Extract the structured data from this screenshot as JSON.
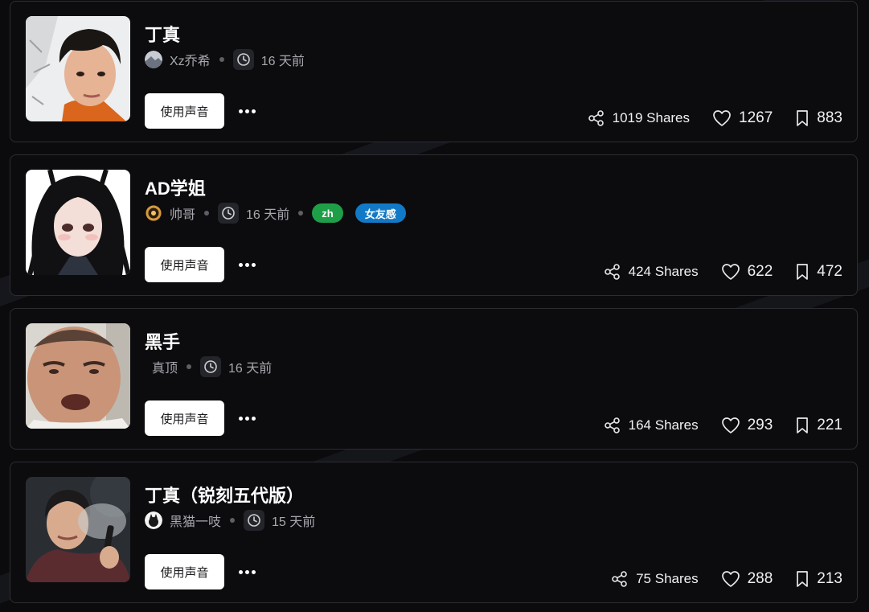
{
  "voices": [
    {
      "title": "丁真",
      "author": "Xz乔希",
      "time": "16 天前",
      "tags": [],
      "use_label": "使用声音",
      "shares": "1019 Shares",
      "likes": "1267",
      "saves": "883"
    },
    {
      "title": "AD学姐",
      "author": "帅哥",
      "time": "16 天前",
      "tags": [
        {
          "label": "zh",
          "color": "#1f9e48"
        },
        {
          "label": "女友感",
          "color": "#1279c7"
        }
      ],
      "use_label": "使用声音",
      "shares": "424 Shares",
      "likes": "622",
      "saves": "472"
    },
    {
      "title": "黑手",
      "author": "真顶",
      "time": "16 天前",
      "tags": [],
      "use_label": "使用声音",
      "shares": "164 Shares",
      "likes": "293",
      "saves": "221"
    },
    {
      "title": "丁真（锐刻五代版）",
      "author": "黑猫一吱",
      "time": "15 天前",
      "tags": [],
      "use_label": "使用声音",
      "shares": "75 Shares",
      "likes": "288",
      "saves": "213"
    }
  ],
  "colors": {
    "background": "#0b0b0d",
    "card_border": "#2c2d33",
    "tag_green": "#1f9e48",
    "tag_blue": "#1279c7"
  },
  "icons": [
    "share-icon",
    "heart-icon",
    "bookmark-icon",
    "clock-icon",
    "more-icon"
  ]
}
